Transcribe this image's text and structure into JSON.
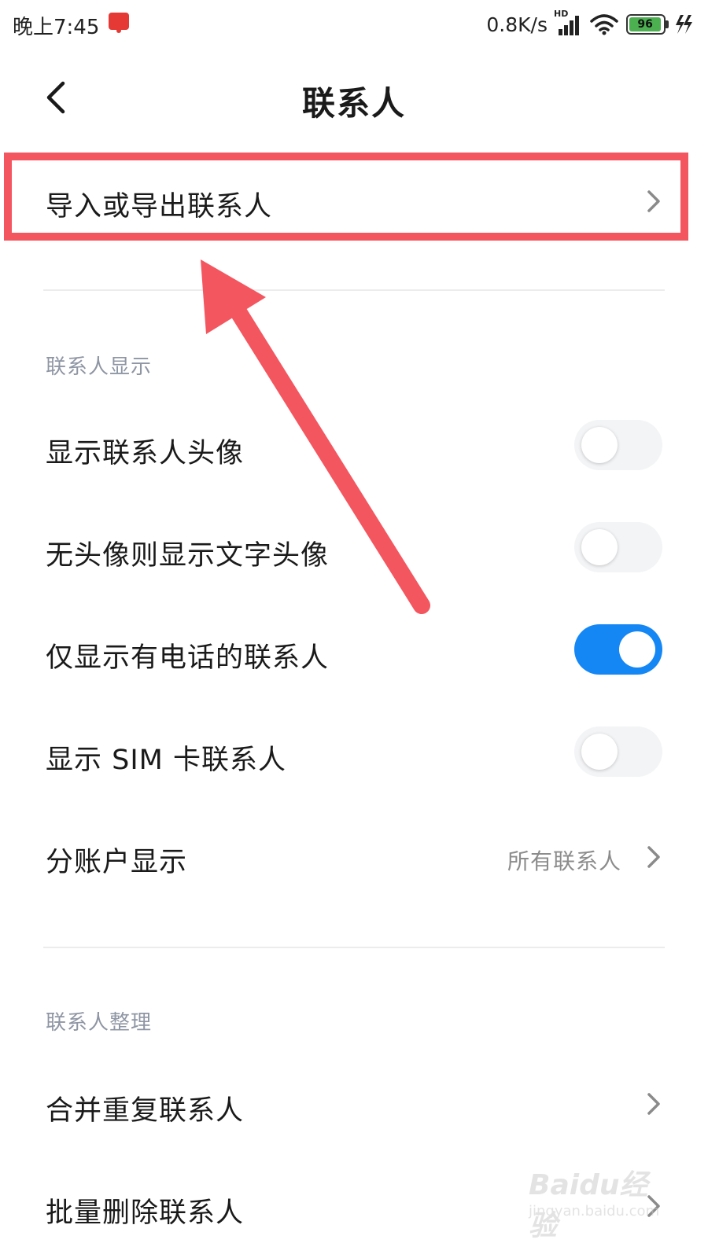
{
  "status_bar": {
    "time": "晚上7:45",
    "net_speed": "0.8K/s",
    "network_type": "HD",
    "battery_level": "96",
    "battery_percent": 96,
    "battery_color": "#4caf50"
  },
  "header": {
    "title": "联系人",
    "back_icon": "chevron-left-icon"
  },
  "import_export": {
    "label": "导入或导出联系人"
  },
  "display_section": {
    "title": "联系人显示",
    "items": [
      {
        "label": "显示联系人头像",
        "enabled": false
      },
      {
        "label": "无头像则显示文字头像",
        "enabled": false
      },
      {
        "label": "仅显示有电话的联系人",
        "enabled": true
      },
      {
        "label": "显示 SIM 卡联系人",
        "enabled": false
      }
    ],
    "account_display": {
      "label": "分账户显示",
      "value": "所有联系人"
    }
  },
  "organize_section": {
    "title": "联系人整理",
    "items": [
      {
        "label": "合并重复联系人"
      },
      {
        "label": "批量删除联系人"
      }
    ]
  },
  "colors": {
    "accent": "#1587f5",
    "highlight": "#f4565f",
    "section_title": "#8e95a3"
  },
  "watermark": {
    "brand": "Baidu经验",
    "url": "jingyan.baidu.com"
  }
}
